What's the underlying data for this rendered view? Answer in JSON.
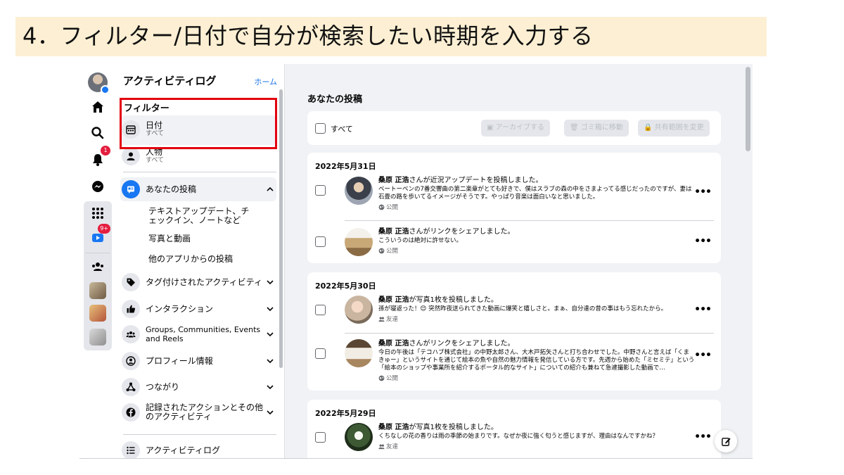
{
  "banner": {
    "text": "4．フィルター/日付で自分が検索したい時期を入力する"
  },
  "rail": {
    "notifications_badge": "1",
    "watch_badge": "9+"
  },
  "sidebar": {
    "title": "アクティビティログ",
    "home_link": "ホーム",
    "filter_heading": "フィルター",
    "filters": [
      {
        "label": "日付",
        "sub": "すべて",
        "icon": "calendar-icon"
      },
      {
        "label": "人物",
        "sub": "すべて",
        "icon": "person-icon"
      }
    ],
    "your_posts": {
      "label": "あなたの投稿",
      "icon": "posts-icon",
      "children": [
        "テキストアップデート、チェックイン、ノートなど",
        "写真と動画",
        "他のアプリからの投稿"
      ]
    },
    "categories": [
      {
        "label": "タグ付けされたアクティビティ",
        "icon": "tag-icon"
      },
      {
        "label": "インタラクション",
        "icon": "thumbs-up-icon"
      },
      {
        "label": "Groups, Communities, Events and Reels",
        "icon": "groups-icon"
      },
      {
        "label": "プロフィール情報",
        "icon": "profile-icon"
      },
      {
        "label": "つながり",
        "icon": "connections-icon"
      },
      {
        "label": "記録されたアクションとその他のアクティビティ",
        "icon": "facebook-icon"
      }
    ],
    "footer_item": {
      "label": "アクティビティログ",
      "icon": "list-icon"
    }
  },
  "main": {
    "title": "あなたの投稿",
    "toolbar": {
      "select_all": "すべて",
      "archive": "アーカイブする",
      "trash": "ゴミ箱に移動",
      "change_audience": "共有範囲を変更"
    },
    "groups": [
      {
        "date": "2022年5月31日",
        "entries": [
          {
            "name": "桑原 正浩",
            "action": "さんが近況アップデートを投稿しました。",
            "desc": "ベートーベンの7番交響曲の第二楽章がとても好きで、僕はスラブの森の中をさまよってる感じだったのですが、妻は石畳の路を歩いてるイメージがそうです。やっぱり音楽は面白いなと思いました。",
            "privacy": "公開",
            "thumb": "portrait"
          },
          {
            "name": "桑原 正浩",
            "action": "さんがリンクをシェアしました。",
            "desc": "こういうのは絶対に許せない。",
            "privacy": "公開",
            "thumb": "building"
          }
        ]
      },
      {
        "date": "2022年5月30日",
        "entries": [
          {
            "name": "桑原 正浩",
            "action": "が写真1枚を投稿しました。",
            "desc": "孫が寝返った！😊 突然昨夜送られてきた動画に爆笑と嬉しさと。まぁ、自分達の昔の事はもう忘れたから。",
            "privacy": "友達",
            "thumb": "photo"
          },
          {
            "name": "桑原 正浩",
            "action": "さんがリンクをシェアしました。",
            "desc": "今日の午後は「テコハブ株式会社」の中野太郎さん、大木戸拓矢さんと打ち合わせでした。中野さんと言えば「くまきゅー」というサイトを通じて絵本の魚や自然の魅力情報を発信している方です。先週から始めた「ミセミテ」という「絵本のショップや事業所を紹介するポータル的なサイト」についての紹介も兼ねて急遽撮影した動画で…",
            "privacy": "公開",
            "thumb": "book"
          }
        ]
      },
      {
        "date": "2022年5月29日",
        "entries": [
          {
            "name": "桑原 正浩",
            "action": "が写真1枚を投稿しました。",
            "desc": "くちなしの花の香りは雨の季節の始まりです。なぜか夜に強く匂うと感じますが、理由はなんですかね？",
            "privacy": "友達",
            "thumb": "flower"
          }
        ]
      }
    ]
  }
}
